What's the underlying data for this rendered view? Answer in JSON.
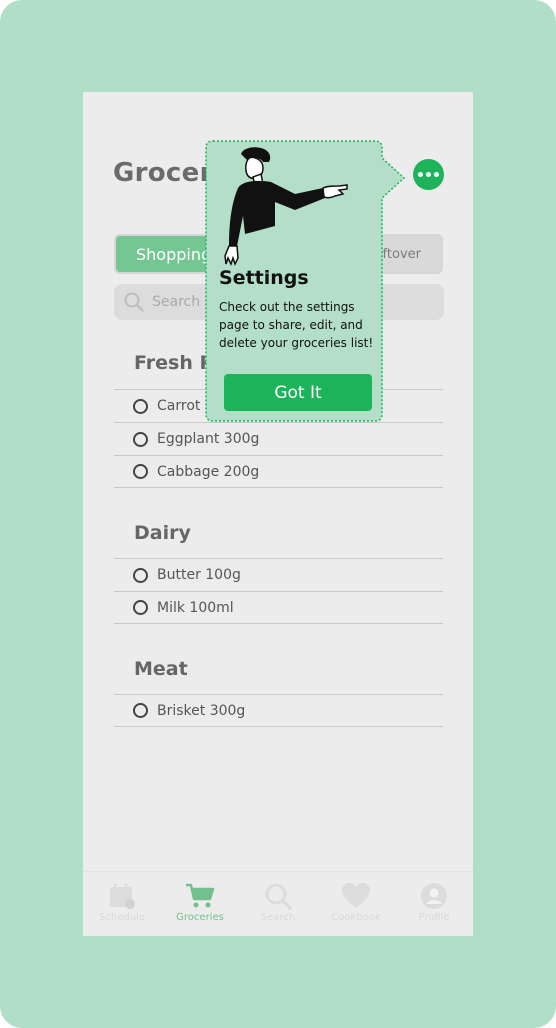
{
  "header": {
    "title": "Grocer"
  },
  "tabs": [
    {
      "label": "Shopping",
      "active": true
    },
    {
      "label": ""
    },
    {
      "label": "eftover"
    }
  ],
  "search": {
    "placeholder": "Search"
  },
  "sections": [
    {
      "title": "Fresh P",
      "items": [
        "Carrot",
        "Eggplant 300g",
        "Cabbage  200g"
      ]
    },
    {
      "title": "Dairy",
      "items": [
        "Butter  100g",
        "Milk 100ml"
      ]
    },
    {
      "title": "Meat",
      "items": [
        "Brisket  300g"
      ]
    }
  ],
  "popover": {
    "title": "Settings",
    "body": "Check out the settings page to share, edit, and delete your groceries list!",
    "button": "Got It"
  },
  "bottom_nav": [
    {
      "label": "Schedule",
      "icon": "calendar-icon"
    },
    {
      "label": "Groceries",
      "icon": "cart-icon",
      "active": true
    },
    {
      "label": "Search",
      "icon": "search-icon"
    },
    {
      "label": "Cookbook",
      "icon": "heart-icon"
    },
    {
      "label": "Profile",
      "icon": "profile-icon"
    }
  ],
  "colors": {
    "frame": "#b0dec7",
    "accent": "#1db35a",
    "tab_active": "#76c694",
    "popover_bg": "#b3dec8"
  }
}
